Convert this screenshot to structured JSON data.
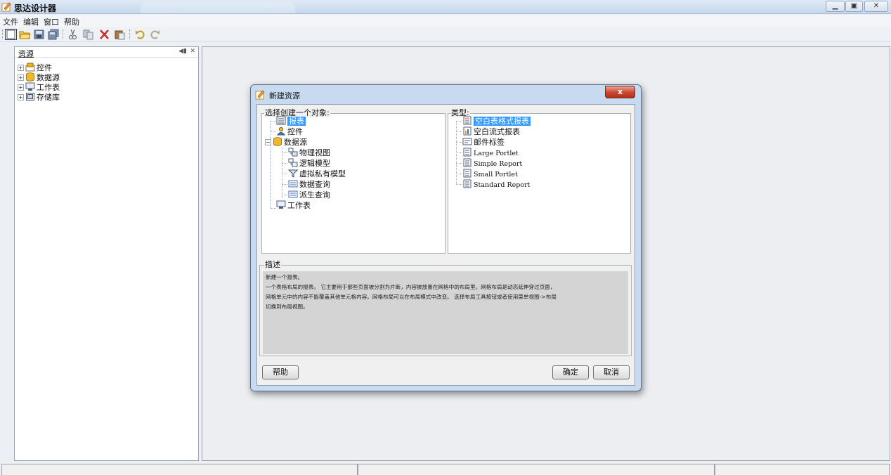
{
  "window": {
    "title": "思达设计器"
  },
  "menu": [
    "文件",
    "编辑",
    "窗口",
    "帮助"
  ],
  "toolbar": {
    "buttons": [
      "new-icon",
      "open-icon",
      "save-icon",
      "save-all-icon",
      "cut-icon",
      "copy-icon",
      "delete-icon",
      "paste-icon",
      "undo-icon",
      "redo-icon"
    ]
  },
  "resources": {
    "title": "资源",
    "items": [
      {
        "label": "控件",
        "icon": "control-icon"
      },
      {
        "label": "数据源",
        "icon": "datasource-icon"
      },
      {
        "label": "工作表",
        "icon": "worksheet-icon"
      },
      {
        "label": "存储库",
        "icon": "repository-icon"
      }
    ]
  },
  "dialog": {
    "title": "新建资源",
    "close_label": "x",
    "object_group_label": "选择创建一个对象:",
    "type_group_label": "类型:",
    "objects": [
      {
        "label": "报表",
        "icon": "report-icon",
        "selected": true
      },
      {
        "label": "控件",
        "icon": "control-icon"
      },
      {
        "label": "数据源",
        "icon": "datasource-icon",
        "expanded": true
      },
      {
        "label": "物理视图",
        "icon": "physical-view-icon"
      },
      {
        "label": "逻辑模型",
        "icon": "logical-model-icon"
      },
      {
        "label": "虚拟私有模型",
        "icon": "virtual-private-model-icon"
      },
      {
        "label": "数据查询",
        "icon": "data-query-icon"
      },
      {
        "label": "派生查询",
        "icon": "derived-query-icon"
      },
      {
        "label": "工作表",
        "icon": "worksheet-icon"
      }
    ],
    "types": [
      {
        "label": "空白表格式报表",
        "icon": "tabular-report-icon",
        "selected": true
      },
      {
        "label": "空白流式报表",
        "icon": "flow-report-icon"
      },
      {
        "label": "邮件标签",
        "icon": "mail-label-icon"
      },
      {
        "label": "Large Portlet",
        "icon": "portlet-icon"
      },
      {
        "label": "Simple Report",
        "icon": "portlet-icon"
      },
      {
        "label": "Small Portlet",
        "icon": "portlet-icon"
      },
      {
        "label": "Standard Report",
        "icon": "portlet-icon"
      }
    ],
    "description_label": "描述",
    "description_lines": [
      "新建一个报表。",
      "一个表格布局的报表。 它主要用于那些页面被分割为片断，内容被放置在网格中的布局里。网格布局是动态延伸穿过页面，",
      "网格单元中的内容不能覆盖其他单元格内容。网格布局可以在布局模式中改变。 选择布局工具按钮或者使用菜单视图->布局",
      "切换到布局视图。"
    ],
    "help_label": "帮助",
    "ok_label": "确定",
    "cancel_label": "取消"
  }
}
